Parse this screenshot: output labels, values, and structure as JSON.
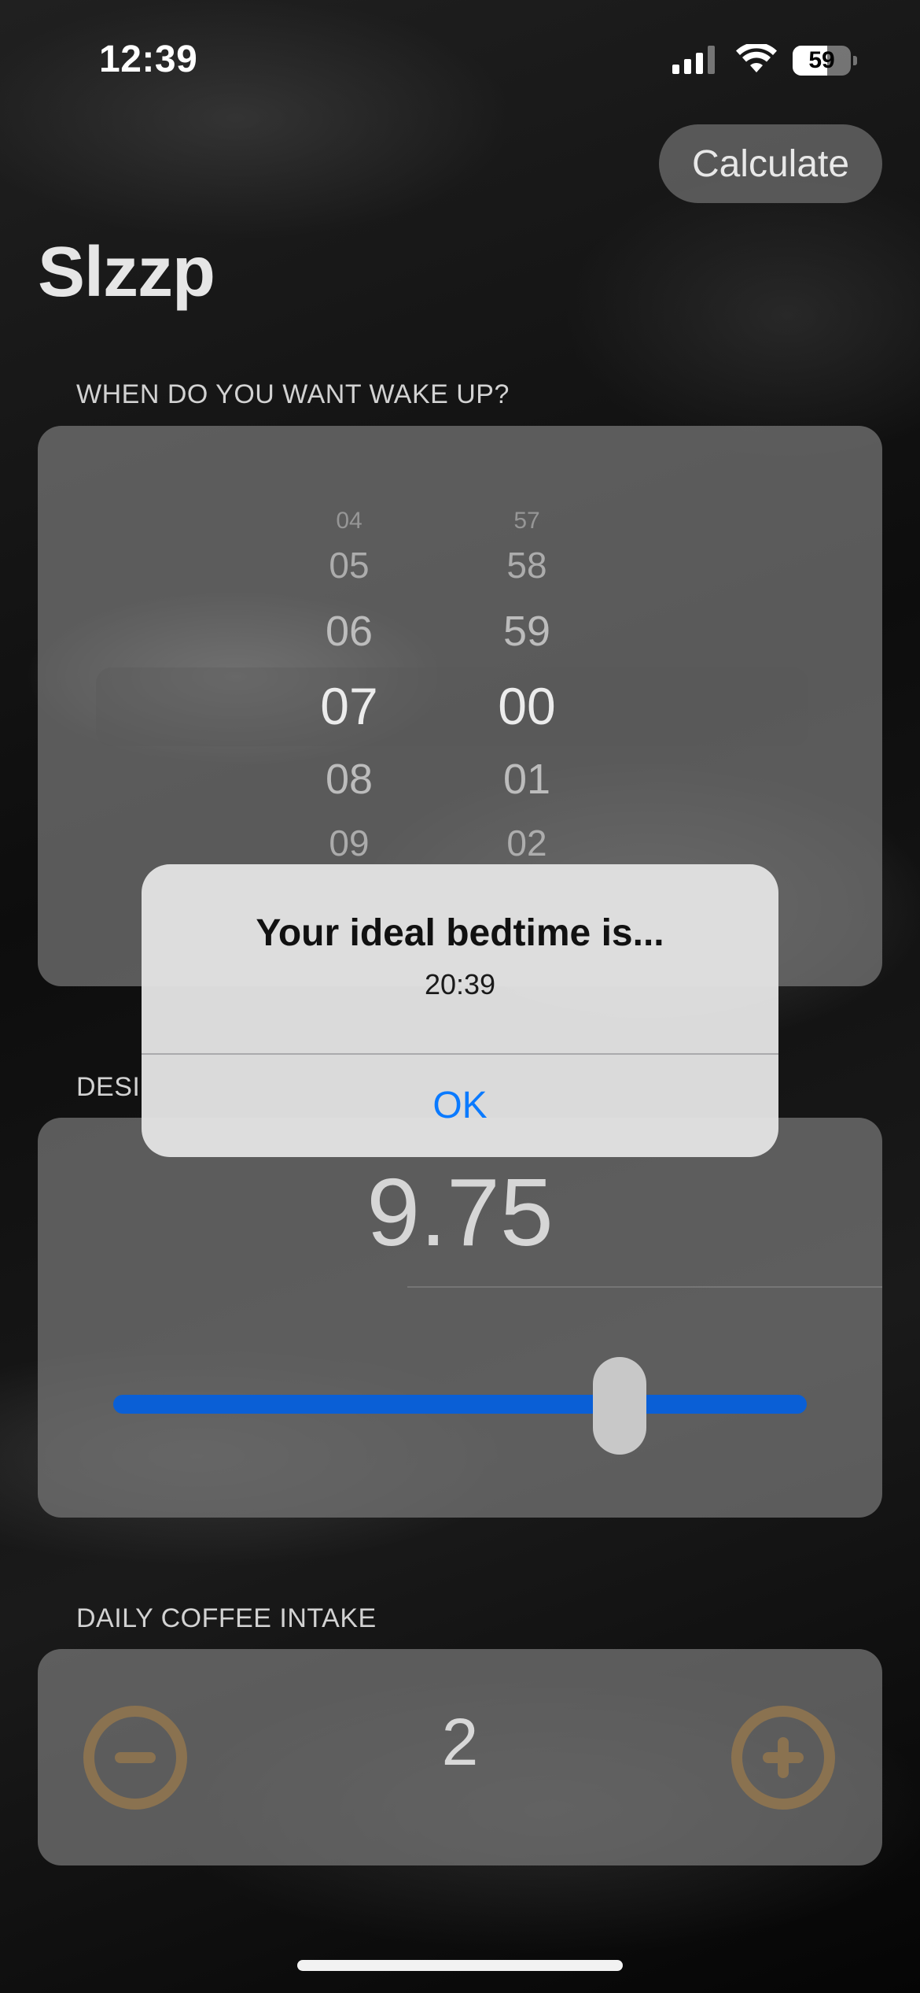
{
  "status_bar": {
    "time": "12:39",
    "battery": "59",
    "battery_level": 0.59,
    "signal_bars": 3
  },
  "toolbar": {
    "calculate_label": "Calculate"
  },
  "app": {
    "title": "Slzzp"
  },
  "wake_section": {
    "header": "WHEN DO YOU WANT WAKE UP?",
    "hours": {
      "values": [
        "04",
        "05",
        "06",
        "07",
        "08",
        "09"
      ],
      "selected": "07"
    },
    "minutes": {
      "values": [
        "57",
        "58",
        "59",
        "00",
        "01",
        "02"
      ],
      "selected": "00"
    }
  },
  "sleep_section": {
    "header": "DESI",
    "value": "9.75",
    "slider_fraction": 0.73
  },
  "coffee_section": {
    "header": "DAILY COFFEE INTAKE",
    "value": "2"
  },
  "alert": {
    "title": "Your ideal bedtime is...",
    "message": "20:39",
    "ok_label": "OK"
  },
  "colors": {
    "accent": "#0a7aff",
    "slider": "#0a5fd6",
    "stepper": "#8a7250"
  }
}
